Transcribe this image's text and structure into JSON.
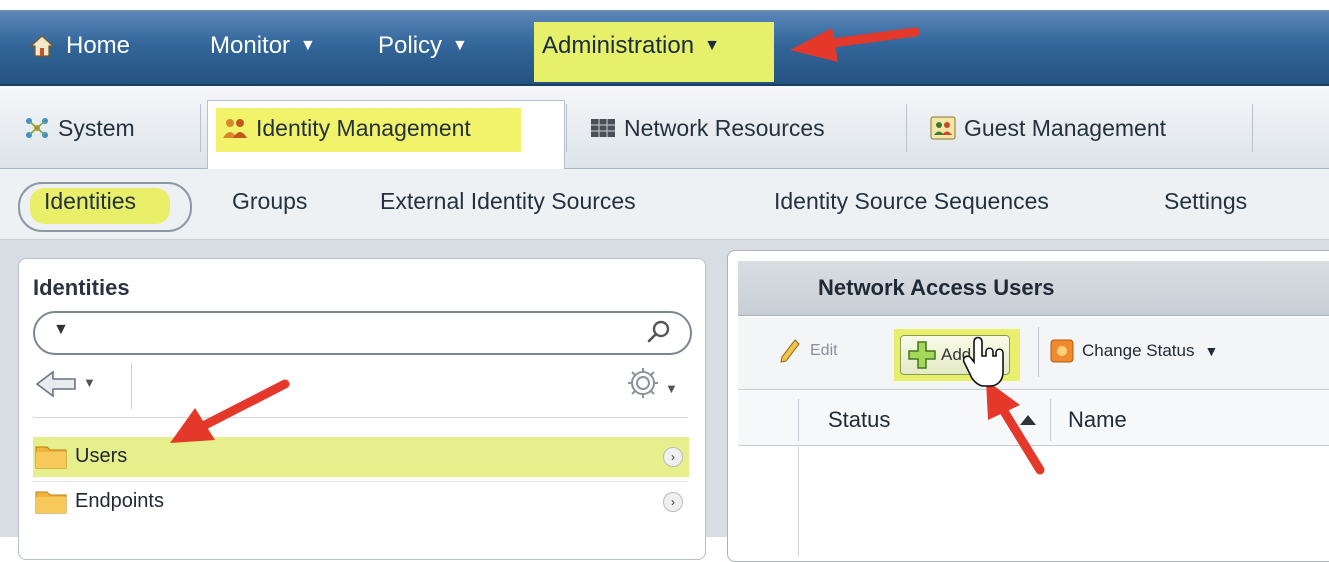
{
  "top_nav": {
    "home": "Home",
    "monitor": "Monitor",
    "policy": "Policy",
    "administration": "Administration",
    "caret": "▼"
  },
  "sub_tabs": {
    "system": "System",
    "identity_management": "Identity Management",
    "network_resources": "Network Resources",
    "guest_management": "Guest Management"
  },
  "third_row": {
    "identities": "Identities",
    "groups": "Groups",
    "external_identity_sources": "External Identity Sources",
    "identity_source_sequences": "Identity Source Sequences",
    "settings": "Settings"
  },
  "left_panel": {
    "title": "Identities",
    "search_value": "",
    "items": [
      {
        "label": "Users",
        "selected": true
      },
      {
        "label": "Endpoints",
        "selected": false
      }
    ]
  },
  "right_panel": {
    "title": "Network Access Users",
    "toolbar": {
      "edit": "Edit",
      "add": "Add",
      "change_status": "Change Status"
    },
    "columns": {
      "status": "Status",
      "name": "Name"
    }
  },
  "colors": {
    "nav_bar": "#33669a",
    "highlight": "#e8ef6c",
    "annotation_arrow": "#e4382a"
  }
}
